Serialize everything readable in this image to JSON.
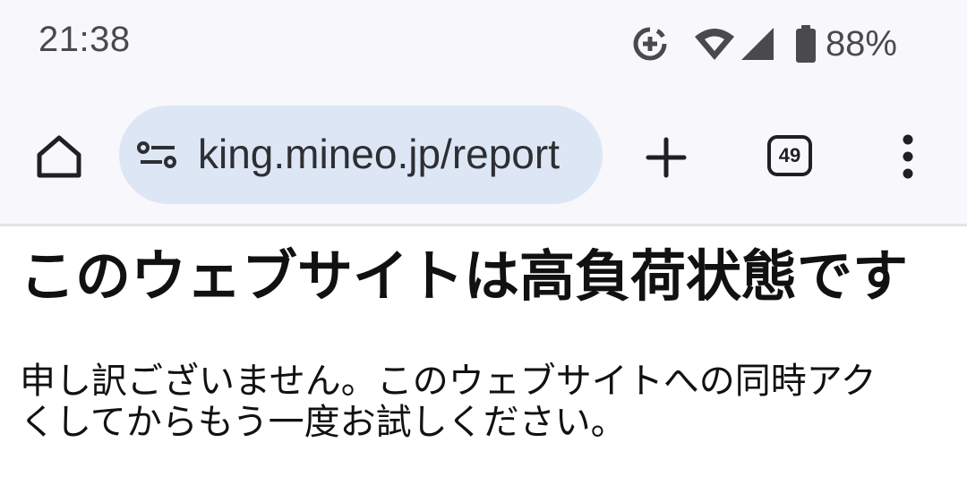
{
  "status_bar": {
    "time": "21:38",
    "battery_percent": "88%",
    "icons": [
      "data-saver-icon",
      "wifi-icon",
      "cell-signal-icon",
      "battery-icon"
    ]
  },
  "toolbar": {
    "url": "king.mineo.jp/report",
    "tab_count": "49",
    "icons": [
      "home-icon",
      "site-info-icon",
      "plus-icon",
      "tab-switcher-icon",
      "more-vert-icon"
    ]
  },
  "page": {
    "heading": "このウェブサイトは高負荷状態です",
    "message_line1": "申し訳ございません。このウェブサイトへの同時アク",
    "message_line2": "くしてからもう一度お試しください。"
  },
  "colors": {
    "toolbar_bg": "#f8f7fc",
    "omnibox_bg": "#dde6f4",
    "icon": "#1f2024",
    "status_text": "#4a4a4e"
  }
}
